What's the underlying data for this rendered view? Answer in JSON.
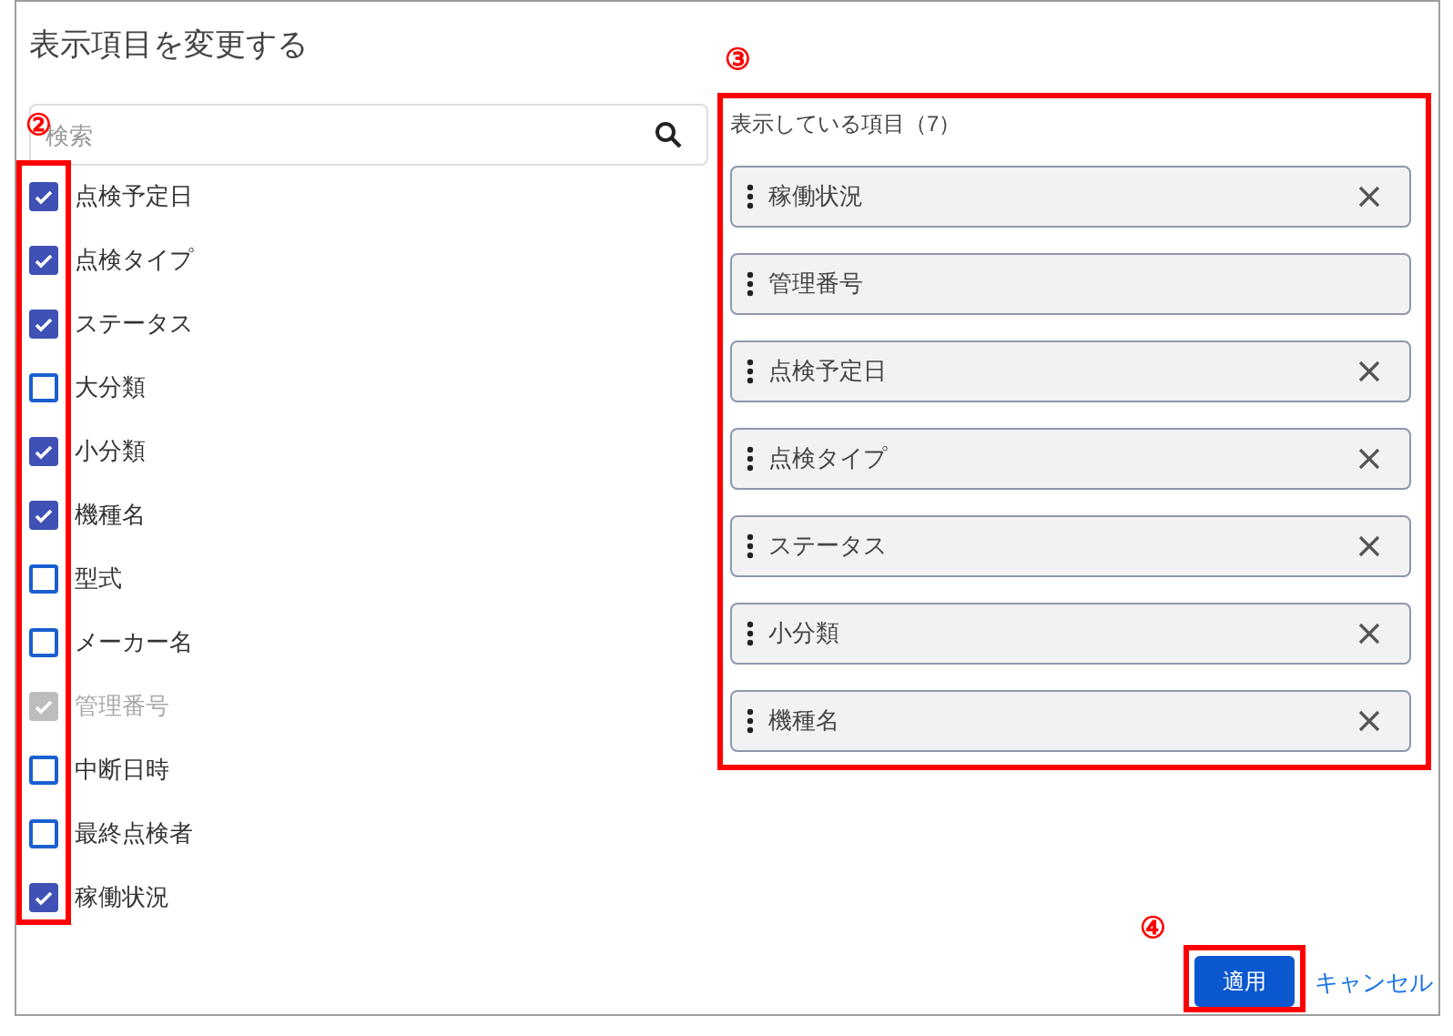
{
  "dialog": {
    "title": "表示項目を変更する"
  },
  "search": {
    "placeholder": "検索"
  },
  "options": [
    {
      "label": "点検予定日",
      "checked": true,
      "disabled": false
    },
    {
      "label": "点検タイプ",
      "checked": true,
      "disabled": false
    },
    {
      "label": "ステータス",
      "checked": true,
      "disabled": false
    },
    {
      "label": "大分類",
      "checked": false,
      "disabled": false
    },
    {
      "label": "小分類",
      "checked": true,
      "disabled": false
    },
    {
      "label": "機種名",
      "checked": true,
      "disabled": false
    },
    {
      "label": "型式",
      "checked": false,
      "disabled": false
    },
    {
      "label": "メーカー名",
      "checked": false,
      "disabled": false
    },
    {
      "label": "管理番号",
      "checked": true,
      "disabled": true
    },
    {
      "label": "中断日時",
      "checked": false,
      "disabled": false
    },
    {
      "label": "最終点検者",
      "checked": false,
      "disabled": false
    },
    {
      "label": "稼働状況",
      "checked": true,
      "disabled": false
    }
  ],
  "shown": {
    "heading": "表示している項目（7）",
    "items": [
      {
        "label": "稼働状況",
        "removable": true
      },
      {
        "label": "管理番号",
        "removable": false
      },
      {
        "label": "点検予定日",
        "removable": true
      },
      {
        "label": "点検タイプ",
        "removable": true
      },
      {
        "label": "ステータス",
        "removable": true
      },
      {
        "label": "小分類",
        "removable": true
      },
      {
        "label": "機種名",
        "removable": true
      }
    ]
  },
  "buttons": {
    "apply": "適用",
    "cancel": "キャンセル"
  },
  "annotations": [
    {
      "label": "②"
    },
    {
      "label": "③"
    },
    {
      "label": "④"
    }
  ]
}
